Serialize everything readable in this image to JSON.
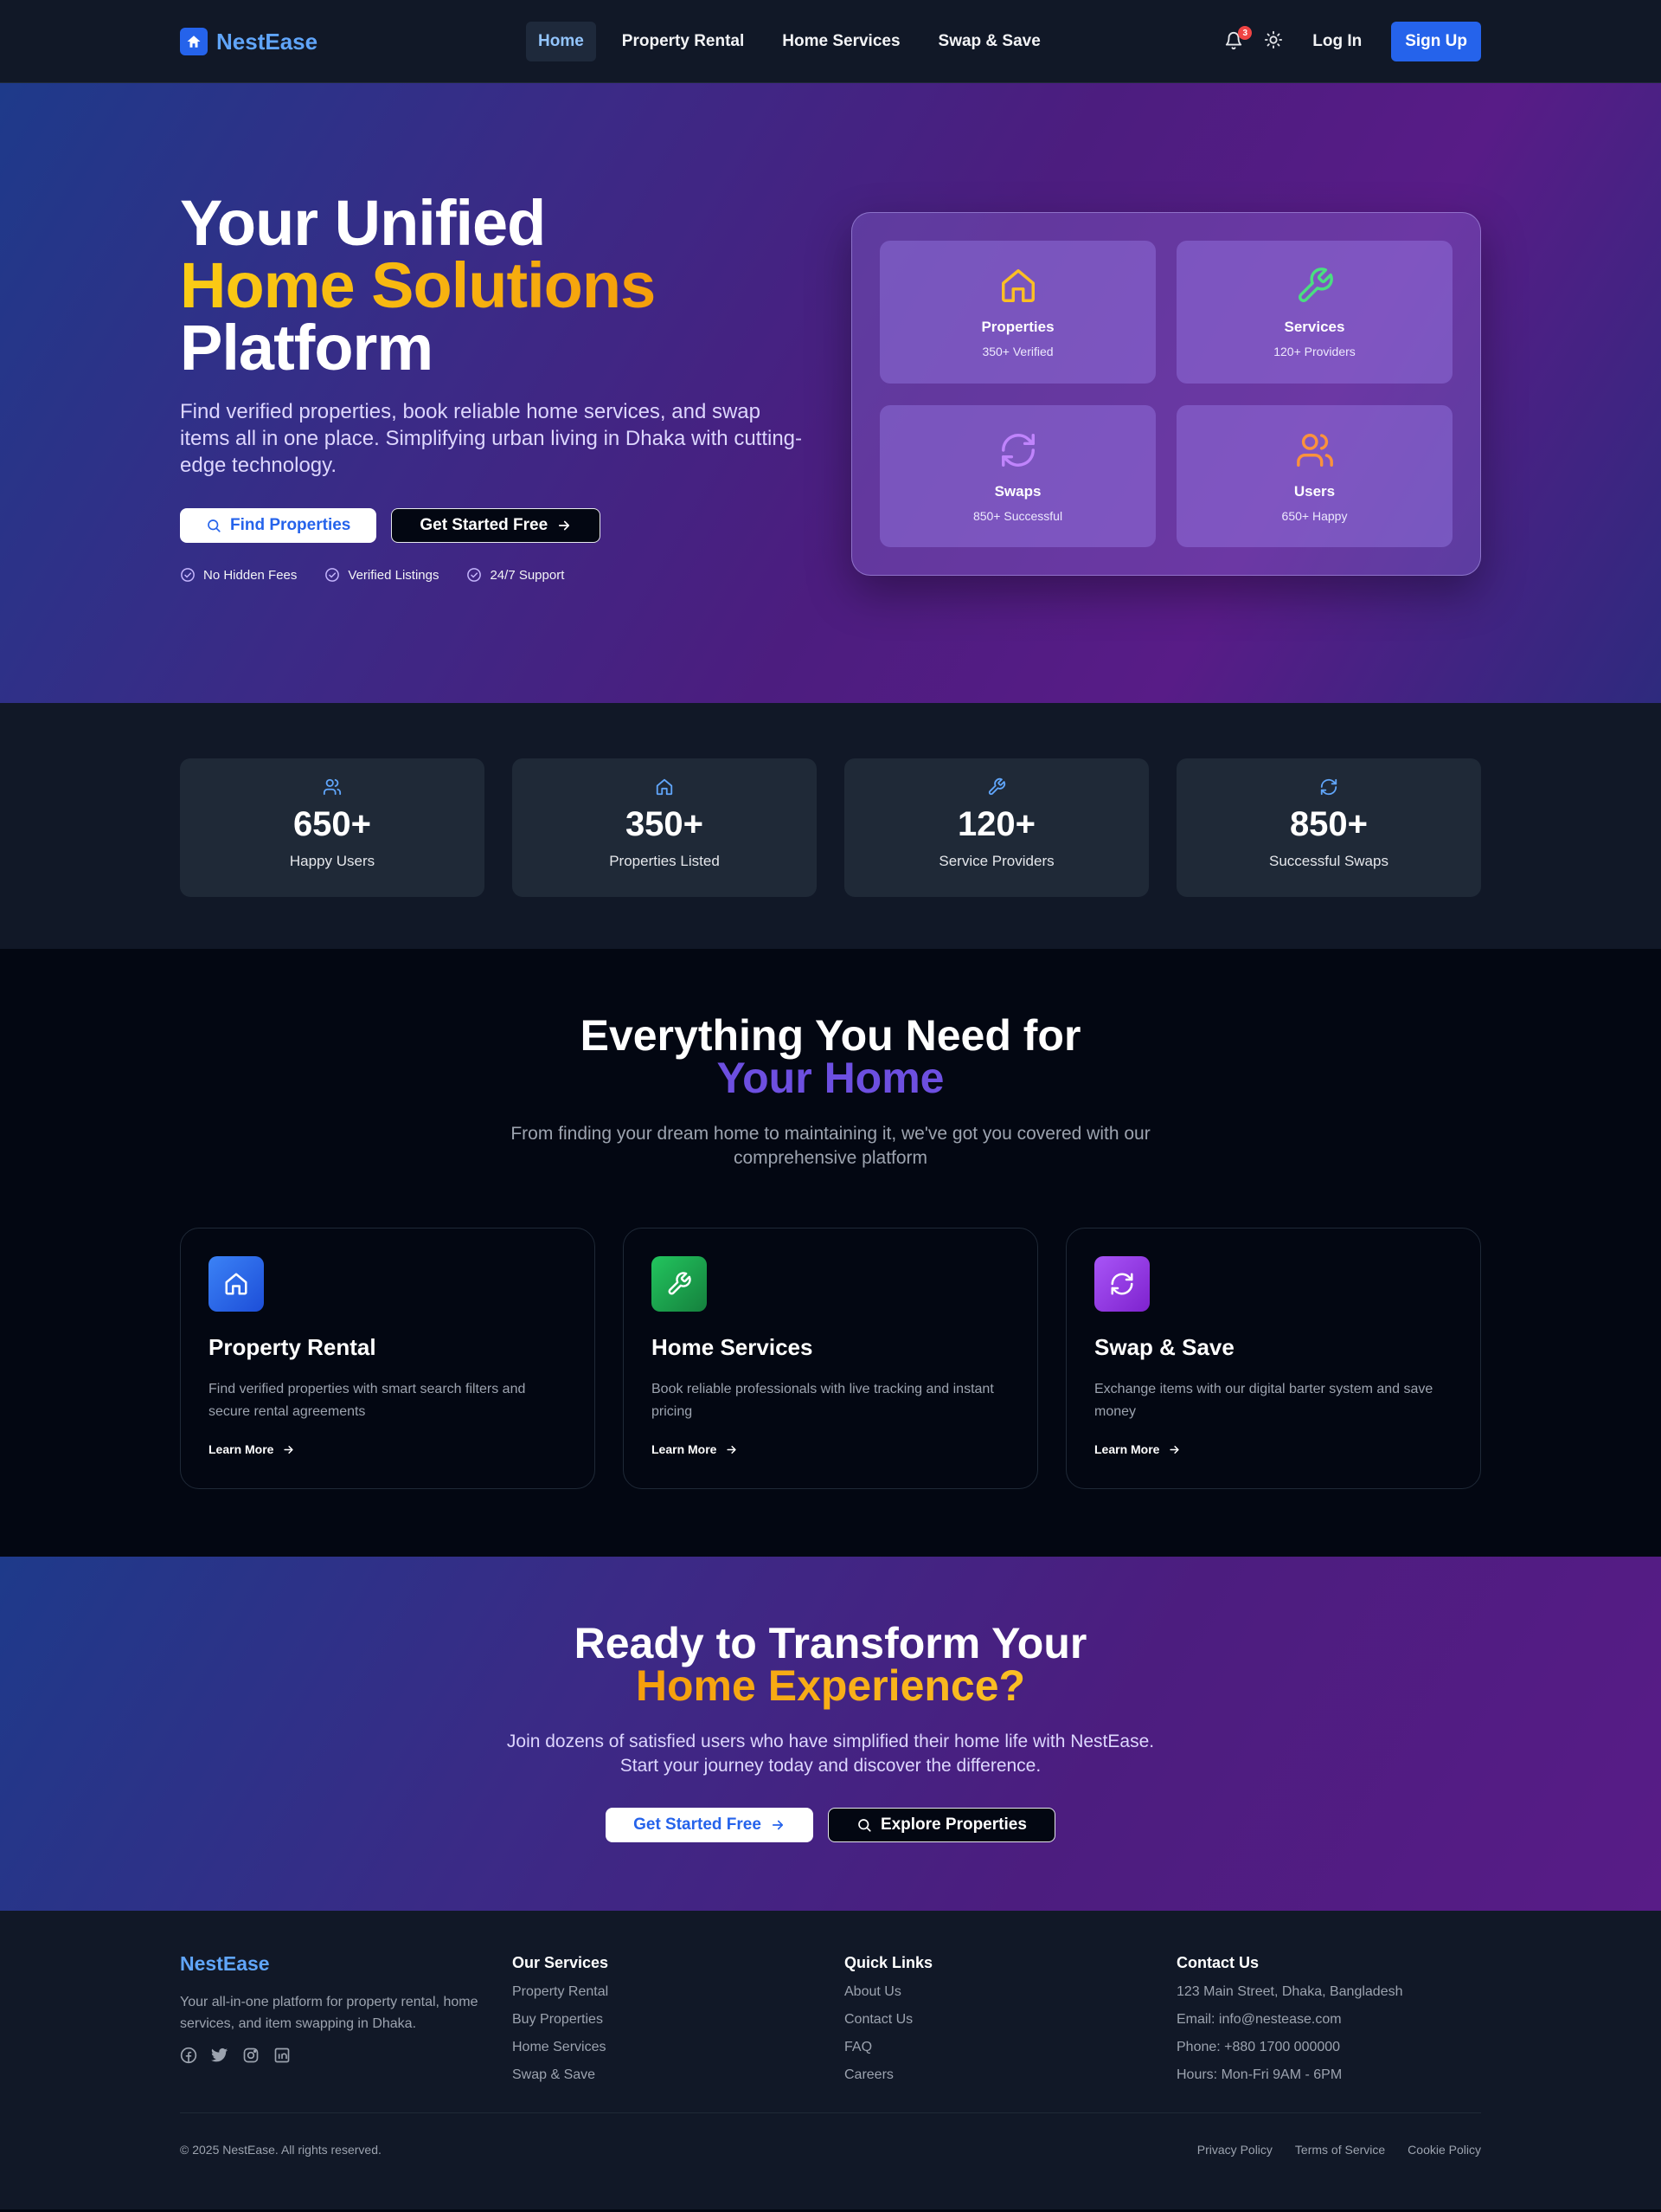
{
  "brand": {
    "name": "NestEase",
    "color": "#60a5fa",
    "icon": "home-icon"
  },
  "nav": {
    "links": [
      {
        "label": "Home",
        "active": true
      },
      {
        "label": "Property Rental",
        "active": false
      },
      {
        "label": "Home Services",
        "active": false
      },
      {
        "label": "Swap & Save",
        "active": false
      }
    ],
    "notifications_count": "3",
    "login_label": "Log In",
    "signup_label": "Sign Up"
  },
  "hero": {
    "title_line1": "Your Unified",
    "title_line2": "Home Solutions",
    "title_line3": "Platform",
    "subtitle": "Find verified properties, book reliable home services, and swap items all in one place. Simplifying urban living in Dhaka with cutting-edge technology.",
    "primary_button": "Find Properties",
    "secondary_button": "Get Started Free",
    "checks": [
      "No Hidden Fees",
      "Verified Listings",
      "24/7 Support"
    ],
    "panel": [
      {
        "title": "Properties",
        "sub": "350+ Verified",
        "icon": "home-icon",
        "color": "#fbbf24"
      },
      {
        "title": "Services",
        "sub": "120+ Providers",
        "icon": "wrench-icon",
        "color": "#4ade80"
      },
      {
        "title": "Swaps",
        "sub": "850+ Successful",
        "icon": "refresh-icon",
        "color": "#c084fc"
      },
      {
        "title": "Users",
        "sub": "650+ Happy",
        "icon": "users-icon",
        "color": "#fb923c"
      }
    ]
  },
  "stats": [
    {
      "value": "650+",
      "label": "Happy Users",
      "icon": "users-icon"
    },
    {
      "value": "350+",
      "label": "Properties Listed",
      "icon": "home-icon"
    },
    {
      "value": "120+",
      "label": "Service Providers",
      "icon": "wrench-icon"
    },
    {
      "value": "850+",
      "label": "Successful Swaps",
      "icon": "refresh-icon"
    }
  ],
  "features": {
    "title_line1": "Everything You Need for",
    "title_line2": "Your Home",
    "subtitle": "From finding your dream home to maintaining it, we've got you covered with our comprehensive platform",
    "cards": [
      {
        "title": "Property Rental",
        "desc": "Find verified properties with smart search filters and secure rental agreements",
        "link": "Learn More",
        "icon": "home-icon",
        "color": "#2563eb"
      },
      {
        "title": "Home Services",
        "desc": "Book reliable professionals with live tracking and instant pricing",
        "link": "Learn More",
        "icon": "wrench-icon",
        "color": "#16a34a"
      },
      {
        "title": "Swap & Save",
        "desc": "Exchange items with our digital barter system and save money",
        "link": "Learn More",
        "icon": "refresh-icon",
        "color": "#9333ea"
      }
    ]
  },
  "cta": {
    "title_line1": "Ready to Transform Your",
    "title_line2": "Home Experience?",
    "subtitle": "Join dozens of satisfied users who have simplified their home life with NestEase. Start your journey today and discover the difference.",
    "primary_button": "Get Started Free",
    "secondary_button": "Explore Properties"
  },
  "footer": {
    "brand": "NestEase",
    "description": "Your all-in-one platform for property rental, home services, and item swapping in Dhaka.",
    "socials": [
      "facebook-icon",
      "twitter-icon",
      "instagram-icon",
      "linkedin-icon"
    ],
    "services_heading": "Our Services",
    "services": [
      "Property Rental",
      "Buy Properties",
      "Home Services",
      "Swap & Save"
    ],
    "links_heading": "Quick Links",
    "links": [
      "About Us",
      "Contact Us",
      "FAQ",
      "Careers"
    ],
    "contact_heading": "Contact Us",
    "contact": [
      "123 Main Street, Dhaka, Bangladesh",
      "Email: info@nestease.com",
      "Phone: +880 1700 000000",
      "Hours: Mon-Fri 9AM - 6PM"
    ],
    "copyright": "© 2025 NestEase. All rights reserved.",
    "legal": [
      "Privacy Policy",
      "Terms of Service",
      "Cookie Policy"
    ]
  }
}
